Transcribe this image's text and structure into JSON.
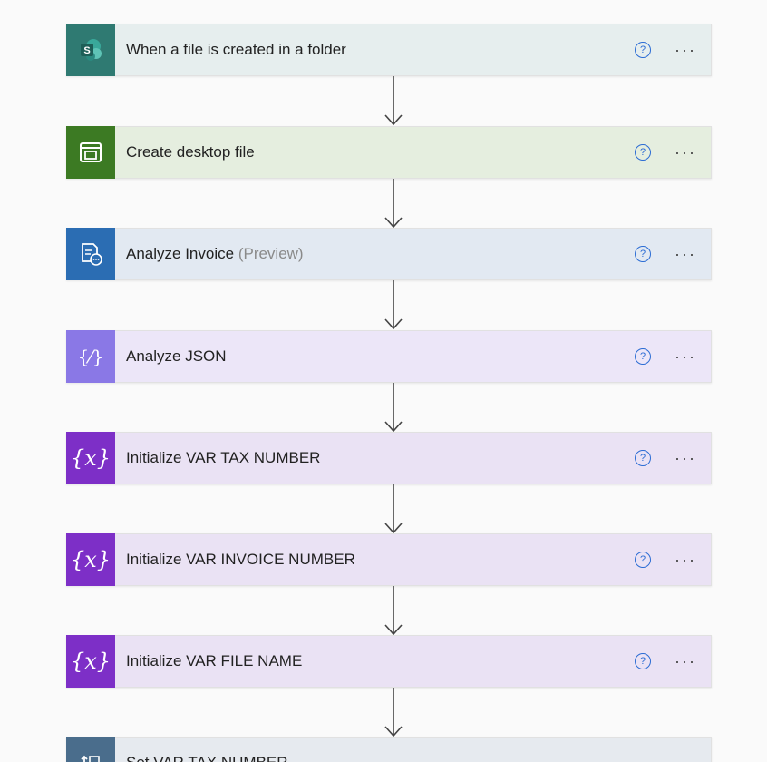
{
  "steps": [
    {
      "label": "When a file is created in a folder",
      "suffix": "",
      "icon": "sharepoint-icon",
      "bg": "#e6eeee",
      "tile": "#2f7a72",
      "has_help": true
    },
    {
      "label": "Create desktop file",
      "suffix": "",
      "icon": "desktop-flow-icon",
      "bg": "#e5eedf",
      "tile": "#3c7a23",
      "has_help": true
    },
    {
      "label": "Analyze Invoice",
      "suffix": "(Preview)",
      "icon": "invoice-processing-icon",
      "bg": "#e2e9f2",
      "tile": "#2b6db3",
      "has_help": true
    },
    {
      "label": "Analyze JSON",
      "suffix": "",
      "icon": "json-icon",
      "bg": "#ece6f8",
      "tile": "#8a78e6",
      "has_help": true
    },
    {
      "label": "Initialize VAR TAX NUMBER",
      "suffix": "",
      "icon": "variable-icon",
      "bg": "#eae2f4",
      "tile": "#7d2fc7",
      "has_help": true
    },
    {
      "label": "Initialize VAR INVOICE NUMBER",
      "suffix": "",
      "icon": "variable-icon",
      "bg": "#eae2f4",
      "tile": "#7d2fc7",
      "has_help": true
    },
    {
      "label": "Initialize VAR FILE NAME",
      "suffix": "",
      "icon": "variable-icon",
      "bg": "#eae2f4",
      "tile": "#7d2fc7",
      "has_help": true
    },
    {
      "label": "Set VAR TAX NUMBER",
      "suffix": "",
      "icon": "set-variable-icon",
      "bg": "#e6eaef",
      "tile": "#4a6d8c",
      "has_help": false
    }
  ],
  "glyphs": {
    "help": "?",
    "more": "···",
    "sharepoint": "S",
    "variable": "{x}",
    "json": "{⁄}"
  },
  "colors": {
    "help_blue": "#2b6cd4",
    "arrow": "#444444"
  }
}
